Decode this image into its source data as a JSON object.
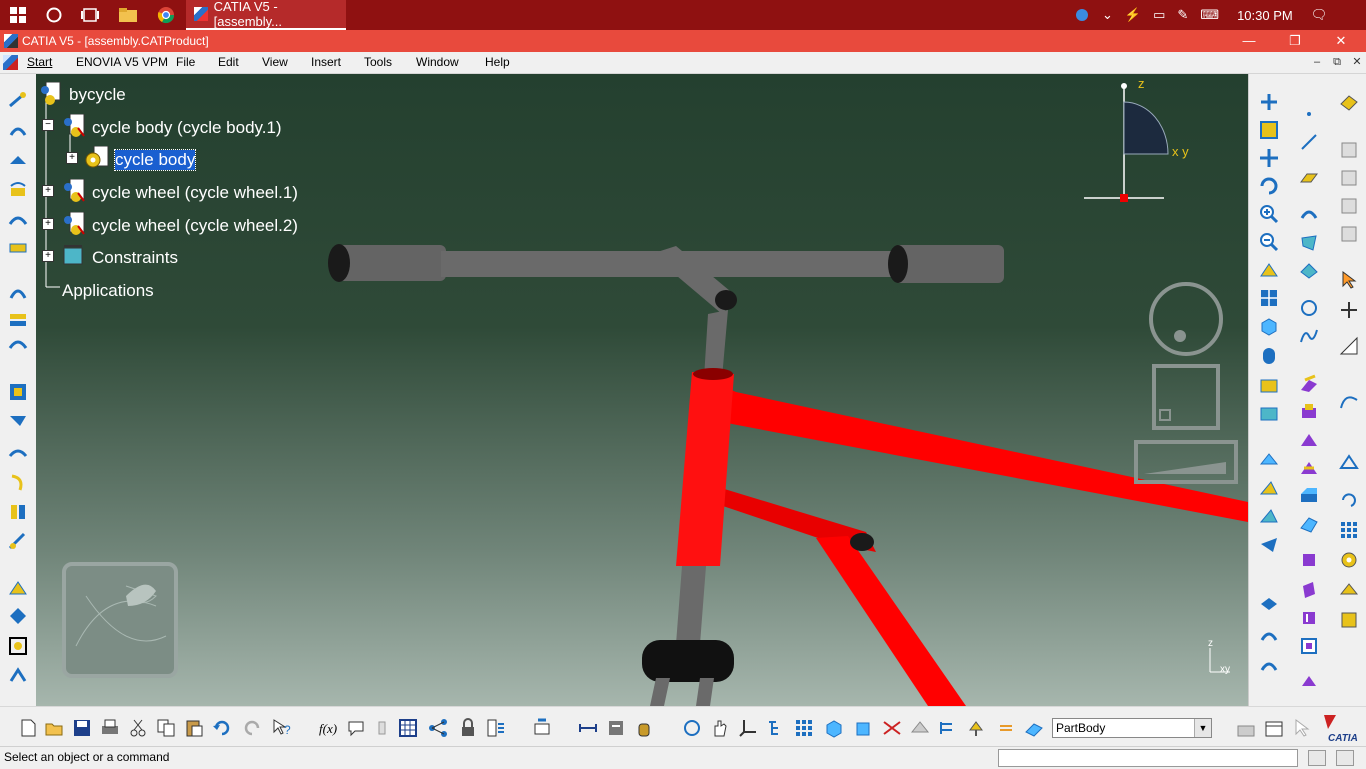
{
  "taskbar": {
    "app_label": "CATIA V5 - [assembly...",
    "clock": "10:30 PM",
    "icons": [
      "windows-start-icon",
      "cortana-icon",
      "task-view-icon",
      "file-explorer-icon",
      "chrome-icon"
    ]
  },
  "window": {
    "title": "CATIA V5 - [assembly.CATProduct]",
    "controls": {
      "minimize": "—",
      "restore": "❐",
      "close": "✕"
    }
  },
  "menu": {
    "items": [
      "Start",
      "ENOVIA V5 VPM",
      "File",
      "Edit",
      "View",
      "Insert",
      "Tools",
      "Window",
      "Help"
    ]
  },
  "tree": {
    "root": "bycycle",
    "items": [
      {
        "label": "cycle body (cycle body.1)"
      },
      {
        "label": "cycle body"
      },
      {
        "label": "cycle wheel (cycle wheel.1)"
      },
      {
        "label": "cycle wheel (cycle wheel.2)"
      },
      {
        "label": "Constraints"
      },
      {
        "label": "Applications"
      }
    ]
  },
  "compass": {
    "z_label": "z",
    "xy_label": "x y"
  },
  "axis_small": {
    "z": "z",
    "xy": "xy"
  },
  "partbody_select": {
    "value": "PartBody"
  },
  "status": {
    "text": "Select an object or a command"
  },
  "colors": {
    "frame_red": "#ff0000",
    "tube_gray": "#6a6a6a",
    "selection_blue": "#1a5fd0",
    "title_red": "#e84a3d",
    "taskbar_red": "#8f1111"
  }
}
